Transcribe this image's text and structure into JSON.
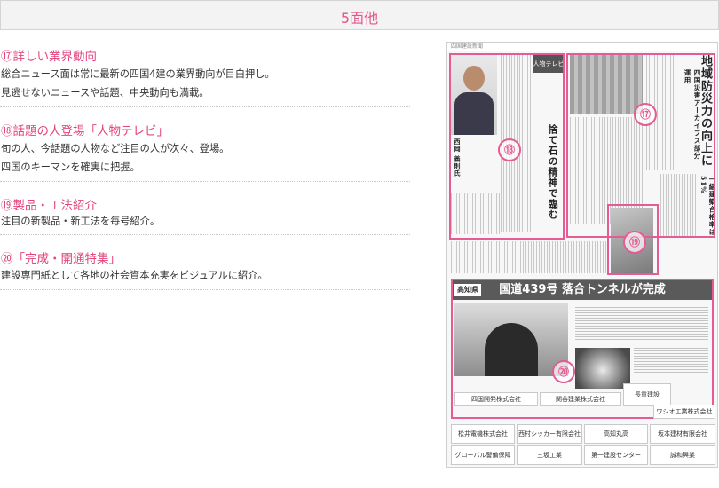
{
  "header": {
    "title": "5面他"
  },
  "features": [
    {
      "title": "⑰詳しい業界動向",
      "lines": [
        "総合ニュース面は常に最新の四国4建の業界動向が目白押し。",
        "見逃せないニュースや話題、中央動向も満載。"
      ]
    },
    {
      "title": "⑱話題の人登場「人物テレビ」",
      "lines": [
        "旬の人、今話題の人物など注目の人が次々、登場。",
        "四国のキーマンを確実に把握。"
      ]
    },
    {
      "title": "⑲製品・工法紹介",
      "lines": [
        "注目の新製品・新工法を毎号紹介。"
      ]
    },
    {
      "title": "⑳「完成・開通特集」",
      "lines": [
        "建設専門紙として各地の社会資本充実をビジュアルに紹介。"
      ]
    }
  ],
  "newspaper": {
    "masthead": "四国建設新聞",
    "badges": [
      "⑰",
      "⑱",
      "⑲",
      "⑳"
    ],
    "headline_disaster": "地域防災力の向上に",
    "subhead_disaster": "四国災害アーカイブス部分運用",
    "headline_person": "捨て石の精神で臨む",
    "person_name": "西岡 義則氏",
    "column_logo": "人物テレビ",
    "exam_head": "一級建築合格率は51%",
    "banner_pref": "高知県",
    "banner_title": "国道439号 落合トンネルが完成",
    "ads": [
      "四国開発株式会社",
      "関谷建業株式会社",
      "長重建設",
      "ワシオ工業株式会社",
      "松井電機株式会社",
      "西村シッカー有限会社",
      "高知丸高",
      "坂本建材有限会社",
      "グローバル警備保障",
      "三坂工業",
      "第一建設センター",
      "誠和興業"
    ]
  }
}
